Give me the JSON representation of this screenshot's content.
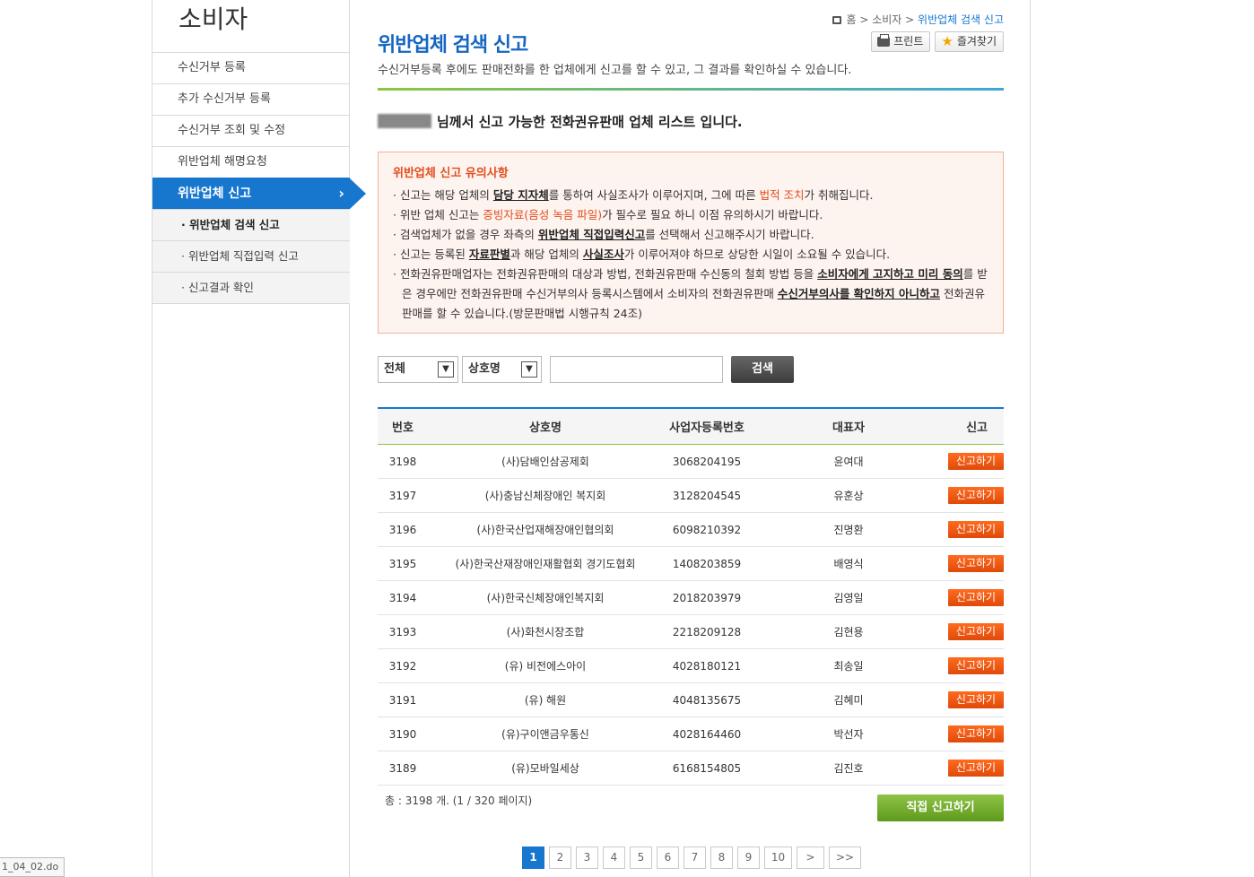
{
  "sidebar": {
    "title": "소비자",
    "items": [
      {
        "label": "수신거부 등록"
      },
      {
        "label": "추가 수신거부 등록"
      },
      {
        "label": "수신거부 조회 및 수정"
      },
      {
        "label": "위반업체 해명요청"
      },
      {
        "label": "위반업체 신고",
        "active": true
      }
    ],
    "sub_items": [
      {
        "label": "· 위반업체 검색 신고",
        "current": true
      },
      {
        "label": "· 위반업체 직접입력 신고"
      },
      {
        "label": "· 신고결과 확인"
      }
    ]
  },
  "breadcrumb": {
    "home": "홈",
    "sep1": ">",
    "level1": "소비자",
    "sep2": ">",
    "current": "위반업체 검색 신고"
  },
  "page": {
    "title": "위반업체 검색 신고",
    "description": "수신거부등록 후에도 판매전화를 한 업체에게 신고를 할 수 있고, 그 결과를 확인하실 수 있습니다.",
    "print_label": "프린트",
    "bookmark_label": "즐겨찾기",
    "user_notice": "님께서 신고 가능한 전화권유판매 업체 리스트 입니다."
  },
  "caution": {
    "title": "위반업체 신고 유의사항",
    "l1a": "· 신고는 해당 업체의 ",
    "l1b": "담당 지자체",
    "l1c": "를 통하여 사실조사가 이루어지며, 그에 따른 ",
    "l1d": "법적 조치",
    "l1e": "가 취해집니다.",
    "l2a": "· 위반 업체 신고는 ",
    "l2b": "증빙자료(음성 녹음 파일)",
    "l2c": "가 필수로 필요 하니 이점 유의하시기 바랍니다.",
    "l3a": "· 검색업체가 없을 경우 좌측의 ",
    "l3b": "위반업체 직접입력신고",
    "l3c": "를 선택해서 신고해주시기 바랍니다.",
    "l4a": "· 신고는 등록된 ",
    "l4b": "자료판별",
    "l4c": "과 해당 업체의 ",
    "l4d": "사실조사",
    "l4e": "가 이루어져야 하므로 상당한 시일이 소요될 수 있습니다.",
    "l5a": "· 전화권유판매업자는 전화권유판매의 대상과 방법, 전화권유판매 수신동의 철회 방법 등을 ",
    "l5b": "소비자에게 고지하고 미리 동의",
    "l5c": "를 받은 경우에만 전화권유판매 수신거부의사 등록시스템에서 소비자의 전화권유판매 ",
    "l5d": "수신거부의사를 확인하지 아니하고",
    "l5e": " 전화권유판매를 할 수 있습니다.(방문판매법 시행규칙 24조)"
  },
  "search": {
    "scope": "전체",
    "field": "상호명",
    "query": "",
    "button": "검색"
  },
  "table": {
    "headers": {
      "no": "번호",
      "name": "상호명",
      "biz_no": "사업자등록번호",
      "rep": "대표자",
      "action": "신고"
    },
    "action_label": "신고하기",
    "rows": [
      {
        "no": "3198",
        "name": "(사)담배인삼공제회",
        "biz_no": "3068204195",
        "rep": "윤여대"
      },
      {
        "no": "3197",
        "name": "(사)충남신체장애인 복지회",
        "biz_no": "3128204545",
        "rep": "유훈상"
      },
      {
        "no": "3196",
        "name": "(사)한국산업재해장애인협의회",
        "biz_no": "6098210392",
        "rep": "진명환"
      },
      {
        "no": "3195",
        "name": "(사)한국산재장애인재활협회 경기도협회",
        "biz_no": "1408203859",
        "rep": "배영식"
      },
      {
        "no": "3194",
        "name": "(사)한국신체장애인복지회",
        "biz_no": "2018203979",
        "rep": "김영일"
      },
      {
        "no": "3193",
        "name": "(사)화천시장조합",
        "biz_no": "2218209128",
        "rep": "김현용"
      },
      {
        "no": "3192",
        "name": "(유) 비전에스아이",
        "biz_no": "4028180121",
        "rep": "최송일"
      },
      {
        "no": "3191",
        "name": "(유) 해원",
        "biz_no": "4048135675",
        "rep": "김혜미"
      },
      {
        "no": "3190",
        "name": "(유)구이앤금우통신",
        "biz_no": "4028164460",
        "rep": "박선자"
      },
      {
        "no": "3189",
        "name": "(유)모바일세상",
        "biz_no": "6168154805",
        "rep": "김진호"
      }
    ]
  },
  "footer": {
    "total": "총 : 3198 개. (1 / 320 페이지)",
    "direct_report": "직접 신고하기"
  },
  "pagination": {
    "pages": [
      "1",
      "2",
      "3",
      "4",
      "5",
      "6",
      "7",
      "8",
      "9",
      "10"
    ],
    "current": "1",
    "next": ">",
    "last": ">>"
  },
  "statusbar": {
    "text": "1_04_02.do"
  }
}
